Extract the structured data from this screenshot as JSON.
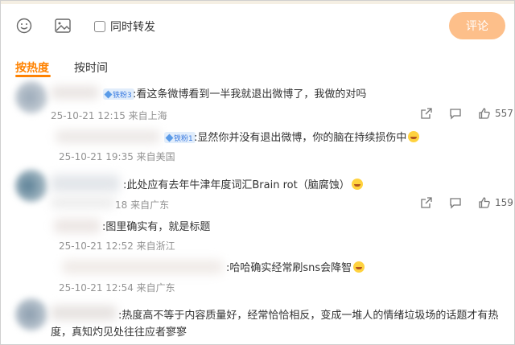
{
  "composer": {
    "emoji_icon": "emoji-smile-icon",
    "image_icon": "image-icon",
    "sync_repost_label": "同时转发",
    "submit_label": "评论"
  },
  "sort_tabs": {
    "hot_label": "按热度",
    "time_label": "按时间"
  },
  "comments": [
    {
      "badge": "铁粉3",
      "text": ":看这条微博看到一半我就退出微博了，我做的对吗",
      "meta": "25-10-21 12:15 来自上海",
      "likes": "557",
      "replies": [
        {
          "badge": "铁粉1",
          "text": ":显然你并没有退出微博，你的脑在持续损伤中",
          "meta": "25-10-21 19:35 来自美国"
        }
      ]
    },
    {
      "text": ":此处应有去年牛津年度词汇Brain rot（脑腐蚀）",
      "meta": "18 来自广东",
      "likes": "159",
      "replies": [
        {
          "text": ":图里确实有，就是标题",
          "meta": "25-10-21 12:52 来自浙江"
        },
        {
          "text": ":哈哈确实经常刷sns会降智",
          "meta": "25-10-21 12:54 来自广东"
        }
      ]
    },
    {
      "text": ":热度高不等于内容质量好，经常恰恰相反，变成一堆人的情绪垃圾场的话题才有热度，真知灼见处往往应者寥寥"
    }
  ],
  "colors": {
    "accent": "#ff8200",
    "submit_bg": "#fdbf8a",
    "meta_gray": "#939393",
    "badge_blue": "#3b7be0"
  }
}
